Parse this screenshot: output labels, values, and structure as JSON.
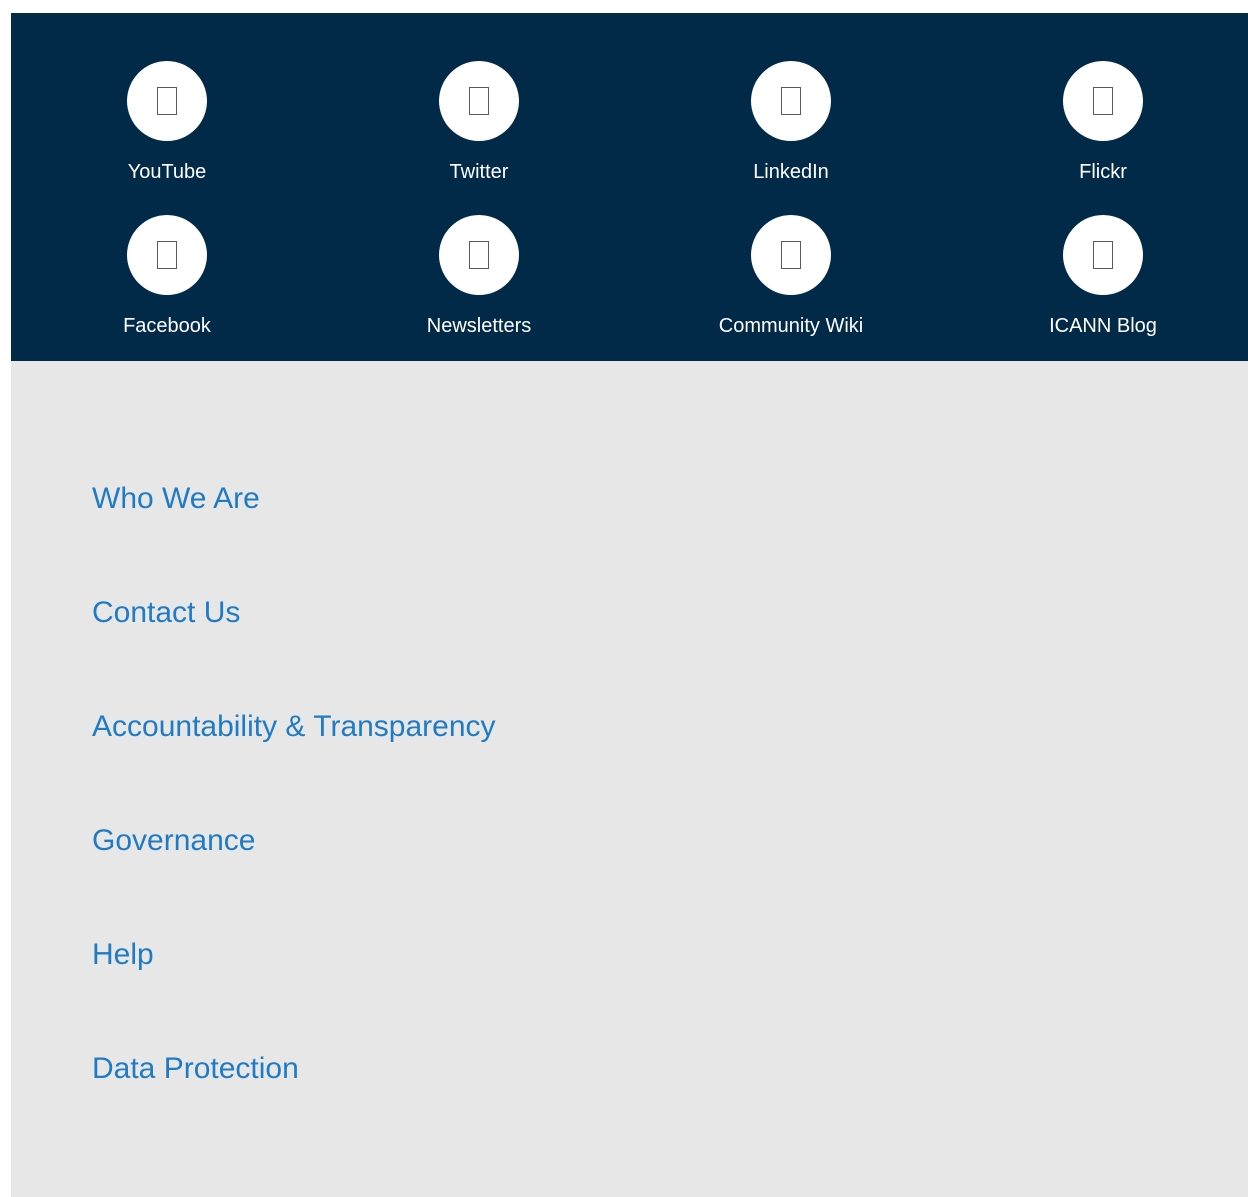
{
  "social": {
    "background": "#012948",
    "items": [
      {
        "label": "YouTube",
        "icon": "youtube-icon"
      },
      {
        "label": "Twitter",
        "icon": "twitter-icon"
      },
      {
        "label": "LinkedIn",
        "icon": "linkedin-icon"
      },
      {
        "label": "Flickr",
        "icon": "flickr-icon"
      },
      {
        "label": "Facebook",
        "icon": "facebook-icon"
      },
      {
        "label": "Newsletters",
        "icon": "newsletter-icon"
      },
      {
        "label": "Community Wiki",
        "icon": "wiki-icon"
      },
      {
        "label": "ICANN Blog",
        "icon": "blog-icon"
      }
    ]
  },
  "footer": {
    "background": "#e7e7e7",
    "link_color": "#1f7bc4",
    "links": [
      {
        "label": "Who We Are"
      },
      {
        "label": "Contact Us"
      },
      {
        "label": "Accountability & Transparency"
      },
      {
        "label": "Governance"
      },
      {
        "label": "Help"
      },
      {
        "label": "Data Protection"
      }
    ]
  }
}
